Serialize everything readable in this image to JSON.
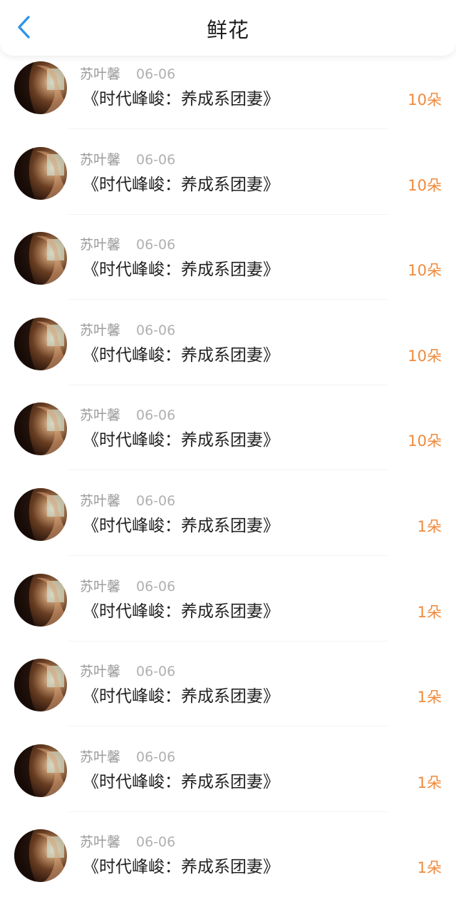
{
  "header": {
    "title": "鲜花",
    "back_icon": "chevron-left-icon",
    "accent_color": "#2f95e8"
  },
  "list": {
    "items": [
      {
        "name": "苏叶馨",
        "date": "06-06",
        "book": "《时代峰峻：养成系团妻》",
        "amount": "10朵"
      },
      {
        "name": "苏叶馨",
        "date": "06-06",
        "book": "《时代峰峻：养成系团妻》",
        "amount": "10朵"
      },
      {
        "name": "苏叶馨",
        "date": "06-06",
        "book": "《时代峰峻：养成系团妻》",
        "amount": "10朵"
      },
      {
        "name": "苏叶馨",
        "date": "06-06",
        "book": "《时代峰峻：养成系团妻》",
        "amount": "10朵"
      },
      {
        "name": "苏叶馨",
        "date": "06-06",
        "book": "《时代峰峻：养成系团妻》",
        "amount": "10朵"
      },
      {
        "name": "苏叶馨",
        "date": "06-06",
        "book": "《时代峰峻：养成系团妻》",
        "amount": "1朵"
      },
      {
        "name": "苏叶馨",
        "date": "06-06",
        "book": "《时代峰峻：养成系团妻》",
        "amount": "1朵"
      },
      {
        "name": "苏叶馨",
        "date": "06-06",
        "book": "《时代峰峻：养成系团妻》",
        "amount": "1朵"
      },
      {
        "name": "苏叶馨",
        "date": "06-06",
        "book": "《时代峰峻：养成系团妻》",
        "amount": "1朵"
      },
      {
        "name": "苏叶馨",
        "date": "06-06",
        "book": "《时代峰峻：养成系团妻》",
        "amount": "1朵"
      }
    ]
  },
  "colors": {
    "amount": "#f08a3c",
    "name": "#9a9a9a",
    "date": "#b0b0b0"
  }
}
